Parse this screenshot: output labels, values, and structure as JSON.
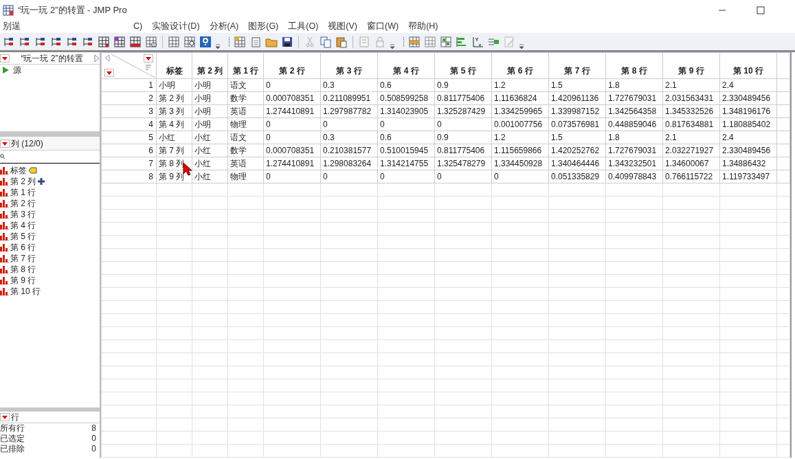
{
  "window": {
    "title": "“玩一玩 2”的转置 - JMP Pro"
  },
  "menu": [
    "别逞",
    "C)",
    "实验设计(D)",
    "分析(A)",
    "图形(G)",
    "工具(O)",
    "视图(V)",
    "窗口(W)",
    "帮助(H)"
  ],
  "table_panel": {
    "title": "“玩一玩 2”的转置",
    "items": [
      {
        "label": "源"
      }
    ]
  },
  "columns_panel": {
    "title": "列 (12/0)",
    "columns": [
      {
        "label": "标签",
        "kind": "label"
      },
      {
        "label": "第 2 列",
        "kind": "plus"
      },
      {
        "label": "第 1 行",
        "kind": "plain"
      },
      {
        "label": "第 2 行",
        "kind": "plain"
      },
      {
        "label": "第 3 行",
        "kind": "plain"
      },
      {
        "label": "第 4 行",
        "kind": "plain"
      },
      {
        "label": "第 5 行",
        "kind": "plain"
      },
      {
        "label": "第 6 行",
        "kind": "plain"
      },
      {
        "label": "第 7 行",
        "kind": "plain"
      },
      {
        "label": "第 8 行",
        "kind": "plain"
      },
      {
        "label": "第 9 行",
        "kind": "plain"
      },
      {
        "label": "第 10 行",
        "kind": "plain"
      }
    ]
  },
  "rows_panel": {
    "title": "行",
    "stats": [
      {
        "label": "所有行",
        "value": "8"
      },
      {
        "label": "已选定",
        "value": "0"
      },
      {
        "label": "已排除",
        "value": "0"
      }
    ]
  },
  "table": {
    "columns": [
      "标签",
      "第 2 列",
      "第 1 行",
      "第 2 行",
      "第 3 行",
      "第 4 行",
      "第 5 行",
      "第 6 行",
      "第 7 行",
      "第 8 行",
      "第 9 行",
      "第 10 行"
    ],
    "rows": [
      {
        "number": "1",
        "cells": [
          "小明",
          "小明",
          "语文",
          "0",
          "0.3",
          "0.6",
          "0.9",
          "1.2",
          "1.5",
          "1.8",
          "2.1",
          "2.4"
        ]
      },
      {
        "number": "2",
        "cells": [
          "第 2 列",
          "小明",
          "数学",
          "0.000708351",
          "0.211089951",
          "0.508599258",
          "0.811775406",
          "1.11636824",
          "1.420961136",
          "1.727679031",
          "2.031563431",
          "2.330489456"
        ]
      },
      {
        "number": "3",
        "cells": [
          "第 3 列",
          "小明",
          "英语",
          "1.274410891",
          "1.297987782",
          "1.314023905",
          "1.325287429",
          "1.334259965",
          "1.339987152",
          "1.342564358",
          "1.345332526",
          "1.348196176"
        ]
      },
      {
        "number": "4",
        "cells": [
          "第 4 列",
          "小明",
          "物理",
          "0",
          "0",
          "0",
          "0",
          "0.001007756",
          "0.073576981",
          "0.448859046",
          "0.817634881",
          "1.180885402"
        ]
      },
      {
        "number": "5",
        "cells": [
          "小红",
          "小红",
          "语文",
          "0",
          "0.3",
          "0.6",
          "0.9",
          "1.2",
          "1.5",
          "1.8",
          "2.1",
          "2.4"
        ]
      },
      {
        "number": "6",
        "cells": [
          "第 7 列",
          "小红",
          "数学",
          "0.000708351",
          "0.210381577",
          "0.510015945",
          "0.811775406",
          "1.115659866",
          "1.420252762",
          "1.727679031",
          "2.032271927",
          "2.330489456"
        ]
      },
      {
        "number": "7",
        "cells": [
          "第 8 列",
          "小红",
          "英语",
          "1.274410891",
          "1.298083264",
          "1.314214755",
          "1.325478279",
          "1.334450928",
          "1.340464446",
          "1.343232501",
          "1.34600067",
          "1.34886432"
        ]
      },
      {
        "number": "8",
        "cells": [
          "第 9 列",
          "小红",
          "物理",
          "0",
          "0",
          "0",
          "0",
          "0",
          "0.051335829",
          "0.409978843",
          "0.766115722",
          "1.119733497"
        ]
      }
    ]
  }
}
